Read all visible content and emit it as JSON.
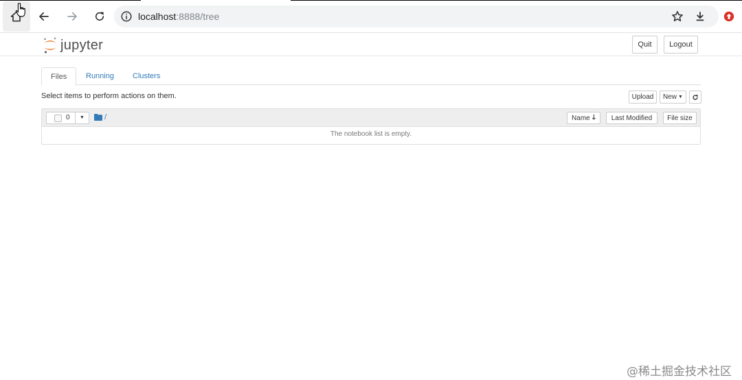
{
  "browser": {
    "url_host": "localhost",
    "url_rest": ":8888/tree",
    "icons": {
      "home": "home-icon",
      "back": "back-arrow-icon",
      "forward": "forward-arrow-icon",
      "reload": "reload-icon",
      "site_info": "info-icon",
      "bookmark": "star-icon",
      "download": "download-icon",
      "extension": "upload-extension-icon"
    },
    "extension_color": "#d93025"
  },
  "header": {
    "logo_text": "jupyter",
    "logo_color": "#f37726",
    "quit_label": "Quit",
    "logout_label": "Logout"
  },
  "tabs": [
    {
      "label": "Files",
      "active": true
    },
    {
      "label": "Running",
      "active": false
    },
    {
      "label": "Clusters",
      "active": false
    }
  ],
  "toolbar": {
    "message": "Select items to perform actions on them.",
    "upload_label": "Upload",
    "new_label": "New",
    "refresh_icon": "refresh-icon"
  },
  "file_list": {
    "selected_count": "0",
    "breadcrumb": "/",
    "columns": {
      "name": "Name",
      "last_modified": "Last Modified",
      "file_size": "File size"
    },
    "empty_message": "The notebook list is empty."
  },
  "watermark": "@稀土掘金技术社区",
  "accent_color": "#337ab7"
}
